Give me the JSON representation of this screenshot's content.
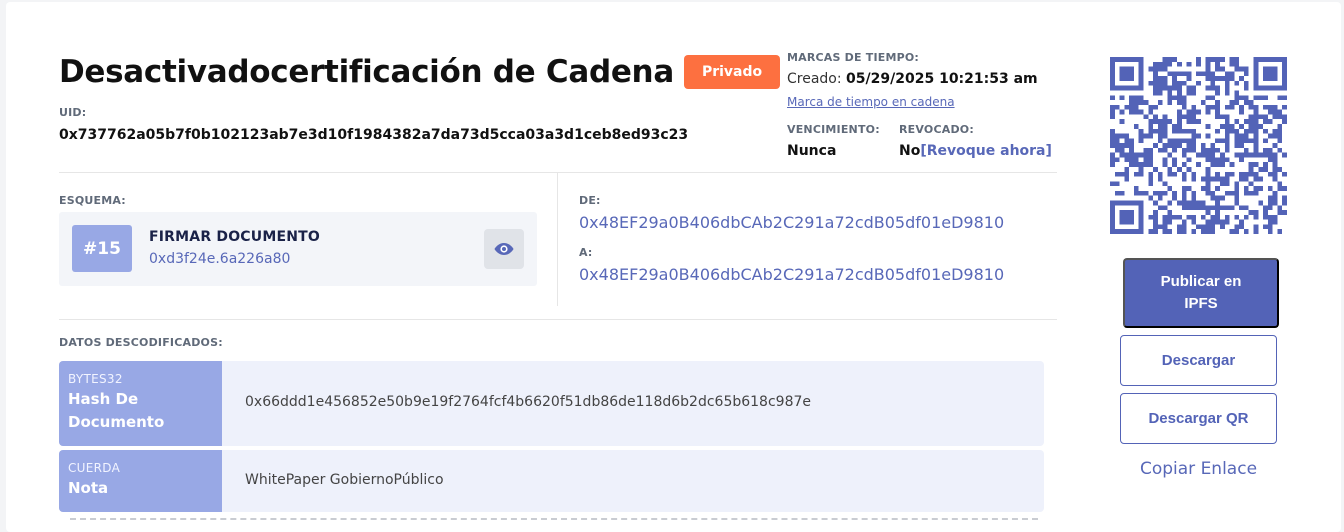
{
  "header": {
    "title": "Desactivadocertificación de Cadena",
    "privacy_badge": "Privado",
    "uid_label": "UID:",
    "uid": "0x737762a05b7f0b102123ab7e3d10f1984382a7da73d5cca03a3d1ceb8ed93c23"
  },
  "timestamps": {
    "label": "MARCAS DE TIEMPO:",
    "created_label": "Creado:",
    "created_value": "05/29/2025 10:21:53 am",
    "chain_link": "Marca de tiempo en cadena",
    "expiration_label": "VENCIMIENTO:",
    "expiration_value": "Nunca",
    "revoked_label": "REVOCADO:",
    "revoked_value": "No",
    "revoke_link": "[Revoque ahora]"
  },
  "schema": {
    "label": "ESQUEMA:",
    "number": "#15",
    "name": "FIRMAR DOCUMENTO",
    "id": "0xd3f24e.6a226a80",
    "view_icon": "eye-icon"
  },
  "parties": {
    "from_label": "DE:",
    "from_value": "0x48EF29a0B406dbCAb2C291a72cdB05df01eD9810",
    "to_label": "A:",
    "to_value": "0x48EF29a0B406dbCAb2C291a72cdB05df01eD9810"
  },
  "decoded": {
    "label": "DATOS DESCODIFICADOS:",
    "rows": [
      {
        "type": "BYTES32",
        "name": "Hash De Documento",
        "value": "0x66ddd1e456852e50b9e19f2764fcf4b6620f51db86de118d6b2dc65b618c987e"
      },
      {
        "type": "CUERDA",
        "name": "Nota",
        "value": "WhitePaper GobiernoPúblico"
      }
    ]
  },
  "actions": {
    "publish": "Publicar en IPFS",
    "download": "Descargar",
    "download_qr": "Descargar QR",
    "copy_link": "Copiar Enlace",
    "qr_icon": "qr-code"
  },
  "colors": {
    "accent": "#5363b7",
    "badge": "#fd7040",
    "key_cell": "#98a8e5",
    "value_bg": "#eef1fb"
  }
}
